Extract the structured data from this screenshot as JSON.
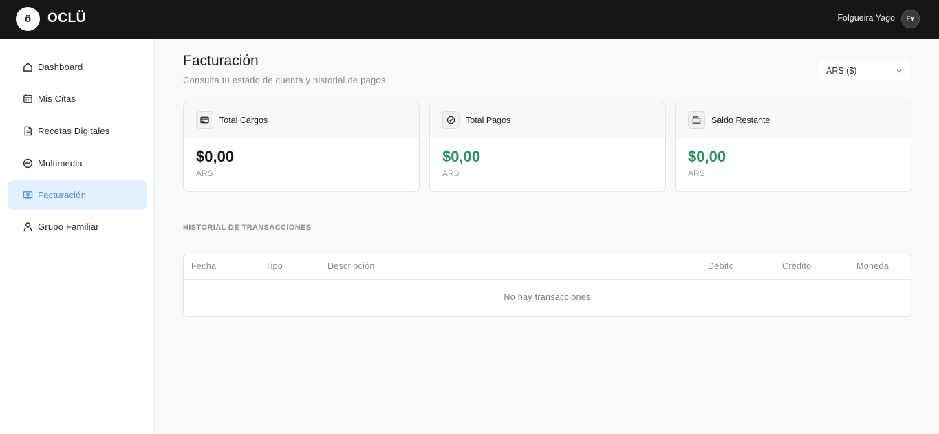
{
  "header": {
    "logo_letter": "ö",
    "brand": "OCLÜ",
    "user_name": "Folgueira Yago",
    "user_initials": "FY"
  },
  "sidebar": {
    "items": [
      {
        "label": "Dashboard",
        "icon": "home-icon",
        "active": false
      },
      {
        "label": "Mis Citas",
        "icon": "calendar-icon",
        "active": false
      },
      {
        "label": "Recetas Digitales",
        "icon": "document-icon",
        "active": false
      },
      {
        "label": "Multimedia",
        "icon": "chart-circle-icon",
        "active": false
      },
      {
        "label": "Facturación",
        "icon": "billing-icon",
        "active": true
      },
      {
        "label": "Grupo Familiar",
        "icon": "user-icon",
        "active": false
      }
    ]
  },
  "main": {
    "title": "Facturación",
    "subtitle": "Consulta tu estado de cuenta y historial de pagos",
    "currency_select": "ARS ($)",
    "cards": [
      {
        "title": "Total Cargos",
        "amount": "$0,00",
        "currency": "ARS",
        "icon": "credit-card-icon"
      },
      {
        "title": "Total Pagos",
        "amount": "$0,00",
        "currency": "ARS",
        "icon": "check-circle-icon"
      },
      {
        "title": "Saldo Restante",
        "amount": "$0,00",
        "currency": "ARS",
        "icon": "wallet-icon"
      }
    ],
    "history_title": "HISTORIAL DE TRANSACCIONES",
    "table": {
      "columns": [
        "Fecha",
        "Tipo",
        "Descripción",
        "Débito",
        "Crédito",
        "Moneda"
      ],
      "empty_text": "No hay transacciones"
    }
  },
  "colors": {
    "topbar": "#161616",
    "active_nav_bg": "#e3f0fd",
    "active_nav_text": "#4a90d9",
    "positive_amount": "#2e8f5e"
  }
}
